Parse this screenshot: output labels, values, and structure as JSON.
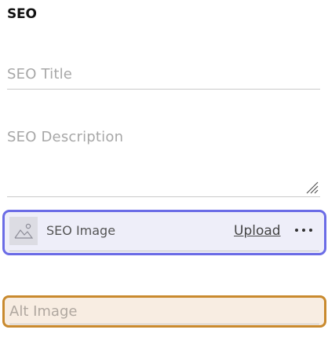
{
  "section": {
    "title": "SEO"
  },
  "fields": {
    "seo_title": {
      "placeholder": "SEO Title",
      "value": ""
    },
    "seo_description": {
      "placeholder": "SEO Description",
      "value": ""
    },
    "seo_image": {
      "label": "SEO Image",
      "upload_label": "Upload",
      "more_label": "more-options",
      "thumbnail_icon": "image-placeholder-icon"
    },
    "alt_image": {
      "placeholder": "Alt Image",
      "value": ""
    }
  },
  "colors": {
    "image_focus_border": "#6b6ce6",
    "image_focus_bg": "#eeeef9",
    "alt_focus_border": "#c98a2e",
    "alt_focus_bg": "#f8ede2"
  }
}
